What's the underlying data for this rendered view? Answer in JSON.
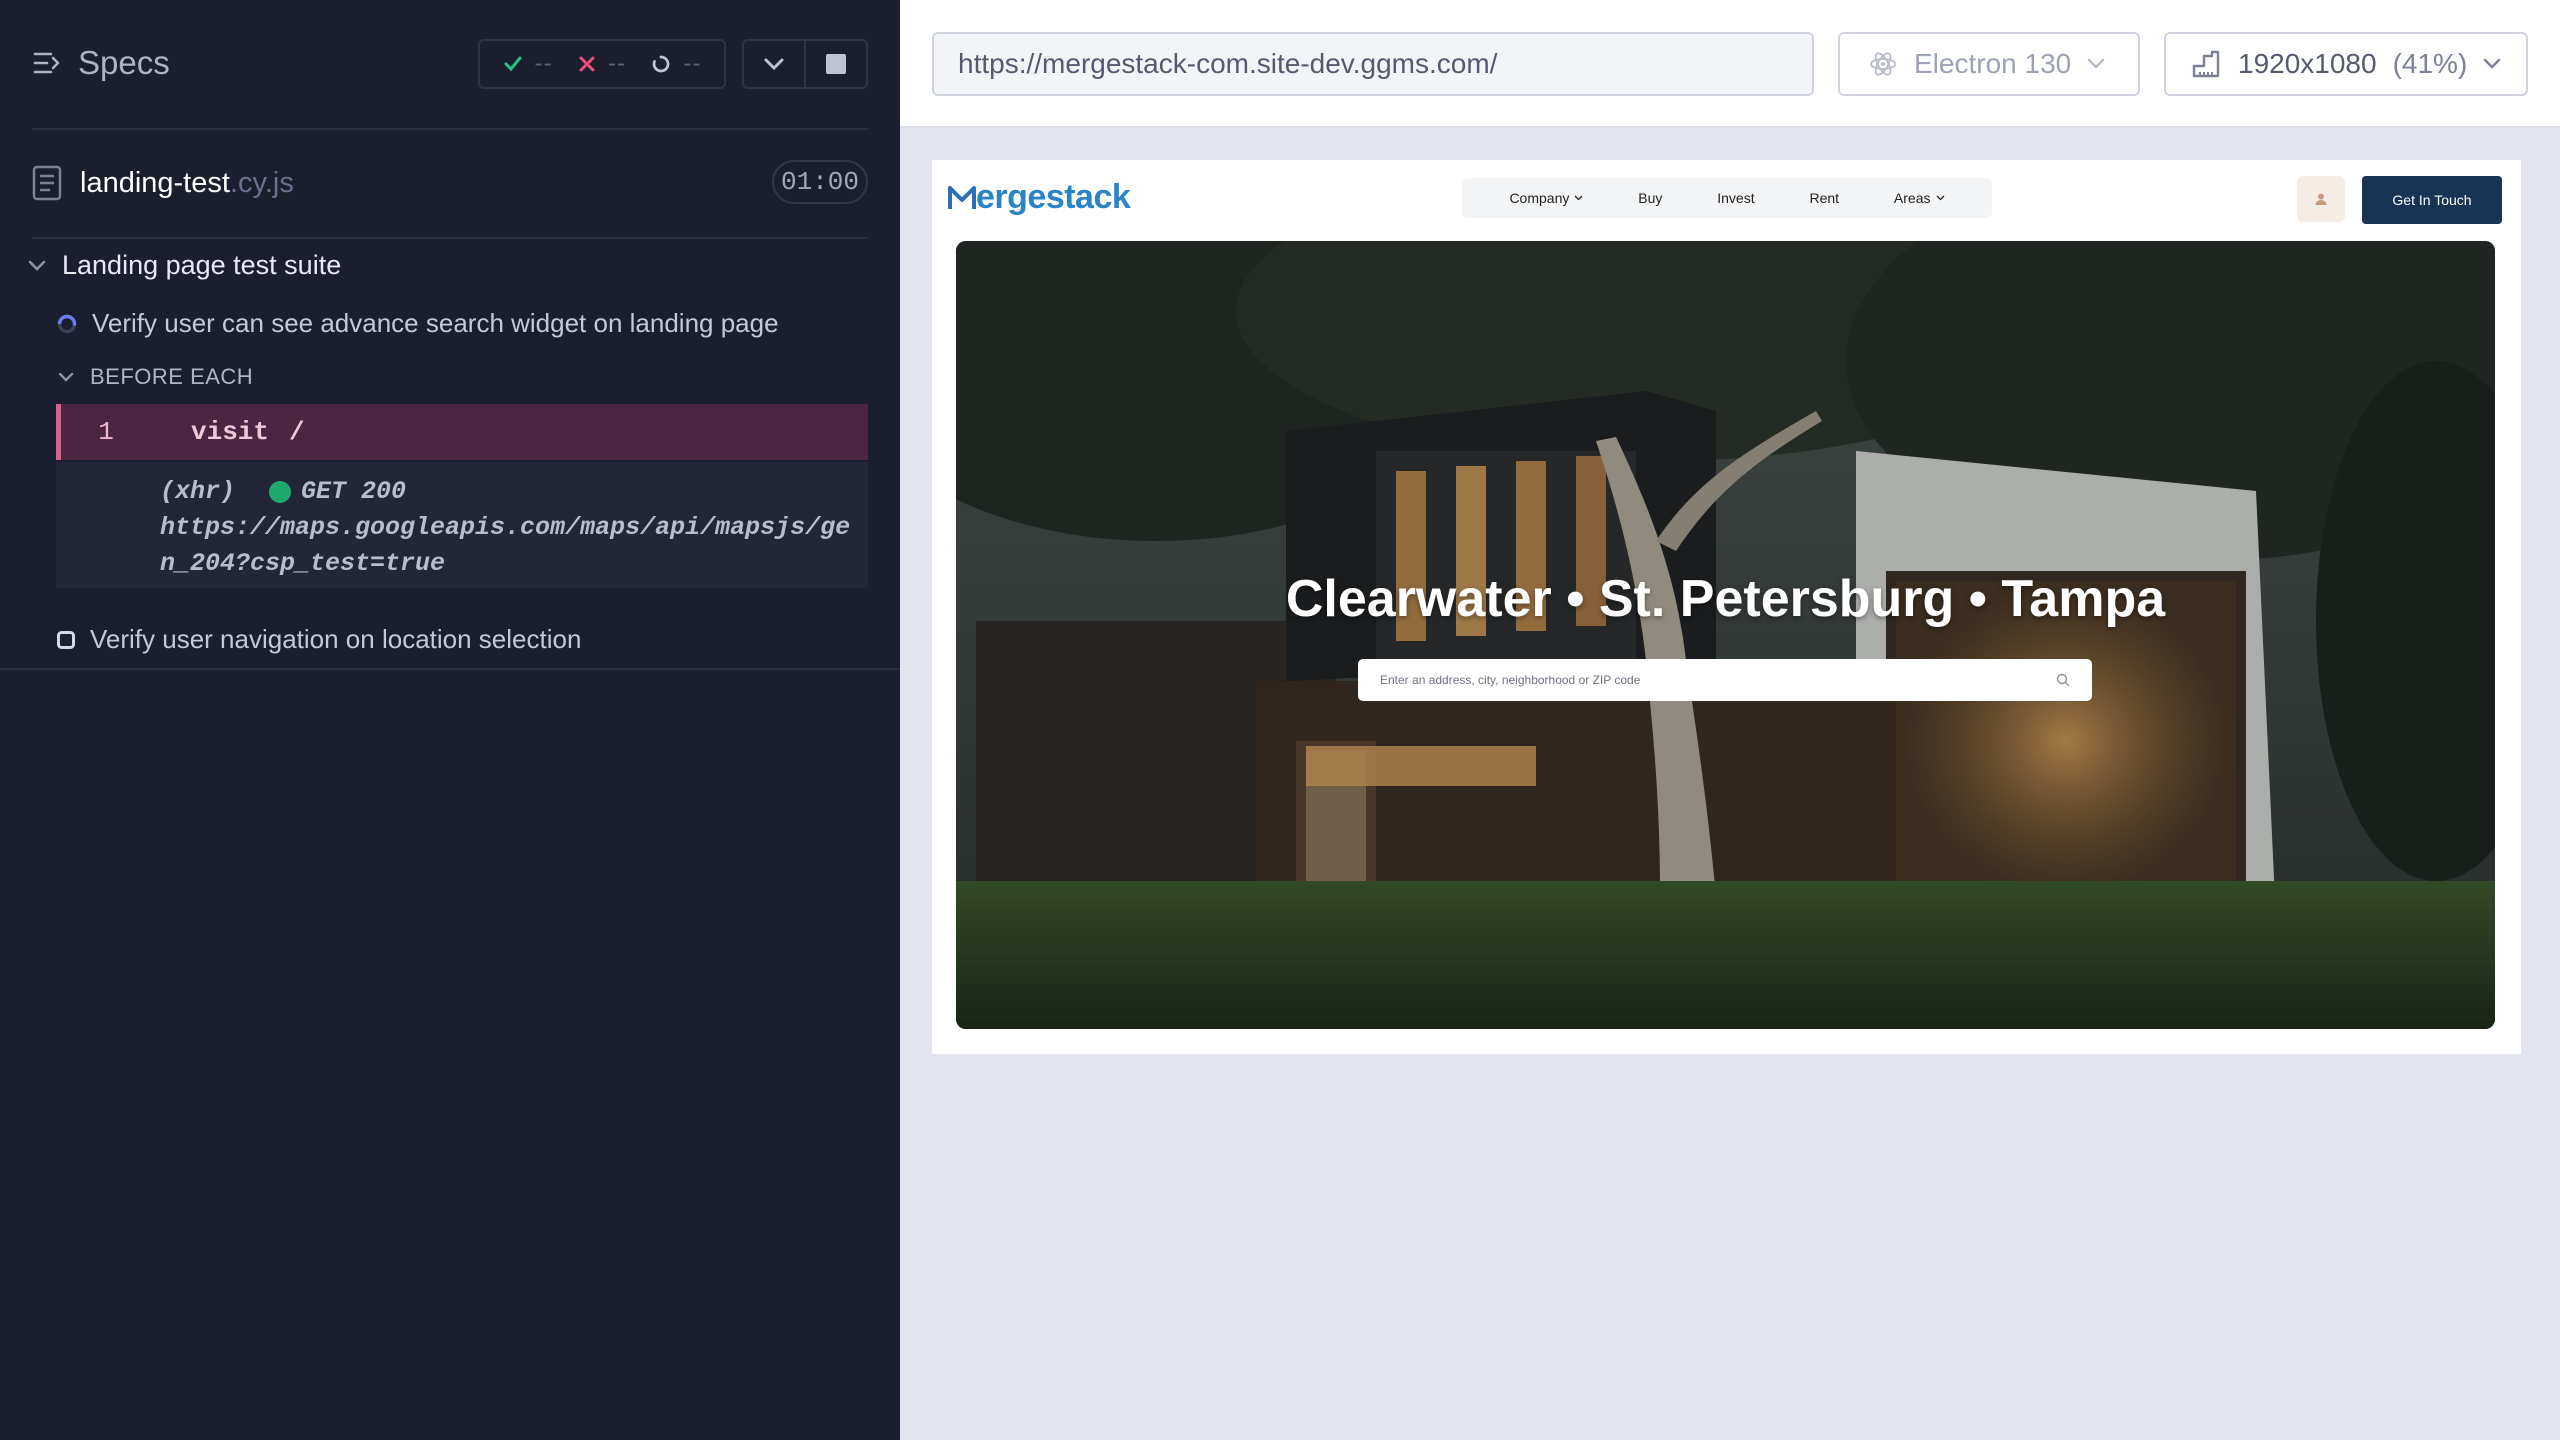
{
  "reporter": {
    "specs_label": "Specs",
    "stats": {
      "passed": "--",
      "failed": "--",
      "pending": "--"
    },
    "file": {
      "name": "landing-test",
      "ext": ".cy.js",
      "duration": "01:00"
    },
    "suite": {
      "title": "Landing page test suite"
    },
    "tests": [
      {
        "title": "Verify user can see advance search widget on landing page",
        "state": "running"
      },
      {
        "title": "Verify user navigation on location selection",
        "state": "pending"
      }
    ],
    "hook": {
      "label": "BEFORE EACH"
    },
    "command": {
      "number": "1",
      "name": "visit",
      "arg": "/"
    },
    "xhr": {
      "tag": "(xhr)",
      "method_status": "GET 200",
      "url": "https://maps.googleapis.com/maps/api/mapsjs/gen_204?csp_test=true"
    }
  },
  "aut": {
    "url": "https://mergestack-com.site-dev.ggms.com/",
    "browser": "Electron 130",
    "viewport": "1920x1080",
    "viewport_scale": "(41%)"
  },
  "site": {
    "logo": "ergestack",
    "logo_m": "M",
    "nav": [
      {
        "label": "Company",
        "has_dropdown": true
      },
      {
        "label": "Buy",
        "has_dropdown": false
      },
      {
        "label": "Invest",
        "has_dropdown": false
      },
      {
        "label": "Rent",
        "has_dropdown": false
      },
      {
        "label": "Areas",
        "has_dropdown": true
      }
    ],
    "cta": "Get In Touch",
    "hero_title": "Clearwater • St. Petersburg • Tampa",
    "search_placeholder": "Enter an address, city, neighborhood or ZIP code"
  },
  "colors": {
    "reporter_bg": "#1b1e2e",
    "command_highlight": "#4a2640",
    "command_border": "#e25d8a",
    "success_green": "#1fa971",
    "cta_navy": "#173454",
    "logo_blue": "#2b84c5"
  },
  "icons": [
    "specs-icon",
    "check-icon",
    "cross-icon",
    "pending-icon",
    "chevron-down-icon",
    "stop-icon",
    "file-icon",
    "spinner-icon",
    "checkbox-icon",
    "electron-icon",
    "viewport-icon",
    "user-icon",
    "search-icon"
  ]
}
